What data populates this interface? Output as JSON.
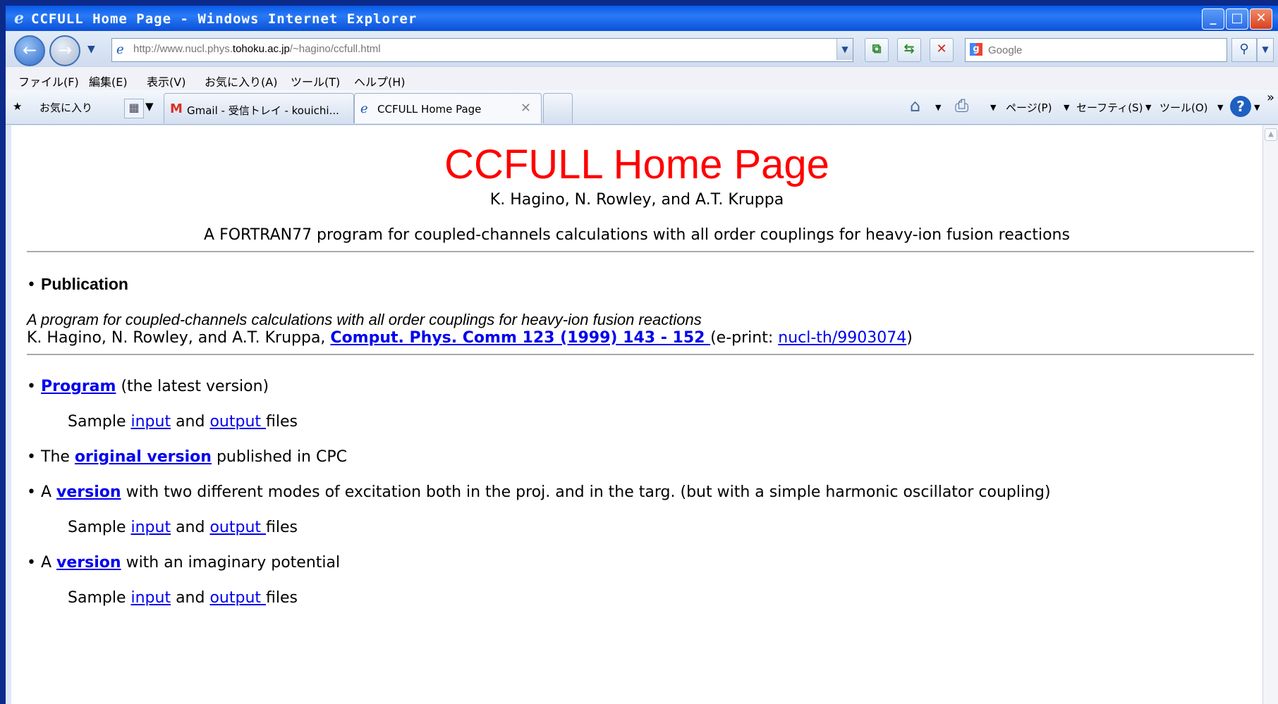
{
  "window": {
    "title": "CCFULL Home Page - Windows Internet Explorer",
    "minimize_label": "_",
    "maximize_label": "□",
    "close_label": "✕"
  },
  "address_bar": {
    "url_prefix": "http://www.nucl.phys.",
    "url_domain": "tohoku.ac.jp",
    "url_path": "/~hagino/ccfull.html",
    "search_placeholder": "Google"
  },
  "menu": [
    "ファイル(F)",
    "編集(E)",
    "表示(V)",
    "お気に入り(A)",
    "ツール(T)",
    "ヘルプ(H)"
  ],
  "favorites_bar": {
    "favorites_label": "お気に入り",
    "tabs": [
      {
        "label": "Gmail - 受信トレイ - kouichi...",
        "icon": "gmail-icon"
      },
      {
        "label": "CCFULL Home Page",
        "icon": "ie-icon"
      }
    ],
    "commands": {
      "page": "ページ(P)",
      "safety": "セーフティ(S)",
      "tools": "ツール(O)"
    }
  },
  "page": {
    "title": "CCFULL Home Page",
    "authors": "K. Hagino, N. Rowley, and A.T. Kruppa",
    "description": "A FORTRAN77 program for coupled-channels calculations with all order couplings for heavy-ion fusion reactions",
    "publication": {
      "heading": "Publication",
      "paper_title": "A program for coupled-channels calculations with all order couplings for heavy-ion fusion reactions",
      "citation_authors": "K. Hagino, N. Rowley, and A.T. Kruppa, ",
      "journal_link": "Comput. Phys. Comm 123 (1999) 143 - 152 ",
      "eprint_prefix": "(e-print: ",
      "eprint_link": "nucl-th/9903074",
      "eprint_suffix": ")"
    },
    "program": {
      "link": "Program",
      "note": " (the latest version)"
    },
    "sample": {
      "prefix": "Sample ",
      "input": "input",
      "and": " and ",
      "output": "output ",
      "files": "files"
    },
    "original": {
      "prefix": "The ",
      "link": "original version",
      "suffix": " published in CPC"
    },
    "version_two_modes": {
      "prefix": "A ",
      "link": "version",
      "suffix": " with two different modes of excitation both in the proj. and in the targ. (but with a simple harmonic oscillator coupling)"
    },
    "version_imaginary": {
      "prefix": "A ",
      "link": "version",
      "suffix": " with an imaginary potential"
    }
  }
}
